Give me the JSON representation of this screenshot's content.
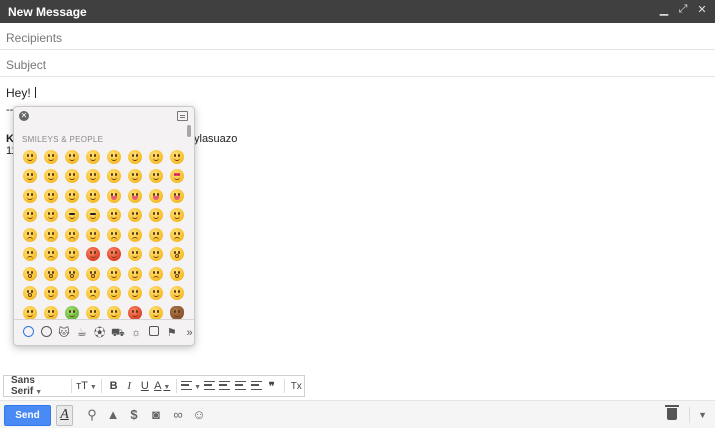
{
  "window": {
    "title": "New Message"
  },
  "compose": {
    "recipients_placeholder": "Recipients",
    "subject_placeholder": "Subject",
    "body_text": "Hey!",
    "signature_dashes": "--",
    "signature_fragment_1": "K",
    "signature_fragment_2": "11",
    "signature_username": "ylasuazo"
  },
  "emoji_picker": {
    "category_heading": "SMILEYS & PEOPLE",
    "emoji_rows": [
      [
        "smile",
        "smile",
        "smile",
        "smile",
        "grin",
        "sweat-smile",
        "laugh",
        "wink"
      ],
      [
        "blush",
        "smile",
        "halo",
        "slight",
        "upside",
        "wink",
        "relieved",
        "heart-eyes"
      ],
      [
        "kiss",
        "kiss",
        "kiss",
        "kiss",
        "yum",
        "tongue",
        "tongue",
        "tongue"
      ],
      [
        "money",
        "hug",
        "nerd",
        "sunglasses",
        "clown",
        "cowboy",
        "smirk",
        "unamused"
      ],
      [
        "sad",
        "pensive",
        "worried",
        "confused",
        "slight-frown",
        "frown",
        "persevere",
        "confounded"
      ],
      [
        "tired",
        "weary",
        "triumph",
        "angry",
        "rage",
        "neutral",
        "expressionless",
        "hushed"
      ],
      [
        "frown-open",
        "anguished",
        "open",
        "astonished",
        "flushed",
        "dizzy",
        "sob",
        "scream"
      ],
      [
        "fear",
        "cold-sweat",
        "cry",
        "disappointed",
        "sweat",
        "sleepy",
        "sleep",
        "zipper"
      ],
      [
        "lying",
        "grimace",
        "nauseated",
        "sneeze",
        "rolling",
        "mouth",
        "drool",
        "poop"
      ],
      [
        "devil",
        "imp",
        "ogre",
        "goblin",
        "skull",
        "ghost",
        "alien",
        "robot"
      ]
    ],
    "tabs": [
      "recent",
      "smileys",
      "animals",
      "food",
      "activity",
      "travel",
      "objects",
      "symbols",
      "flags",
      "more"
    ]
  },
  "format_toolbar": {
    "font_name": "Sans Serif",
    "size_label": "тT",
    "bold_label": "B",
    "italic_label": "I",
    "underline_label": "U",
    "text_color_label": "A",
    "align_label": "align",
    "numbered_list_label": "1≡",
    "bulleted_list_label": "•≡",
    "indent_less_label": "⇤",
    "indent_more_label": "⇥",
    "quote_label": "❞",
    "remove_format_label": "Tx"
  },
  "bottom_bar": {
    "send_label": "Send",
    "format_toggle_label": "A",
    "icons": [
      "attach-icon",
      "drive-icon",
      "money-icon",
      "photo-icon",
      "link-icon",
      "emoji-icon"
    ]
  },
  "colors": {
    "titlebar_bg": "#404040",
    "send_button": "#4a8af4",
    "picker_bg": "#f4f2f2",
    "emoji_yellow": "#f7bf2b"
  }
}
